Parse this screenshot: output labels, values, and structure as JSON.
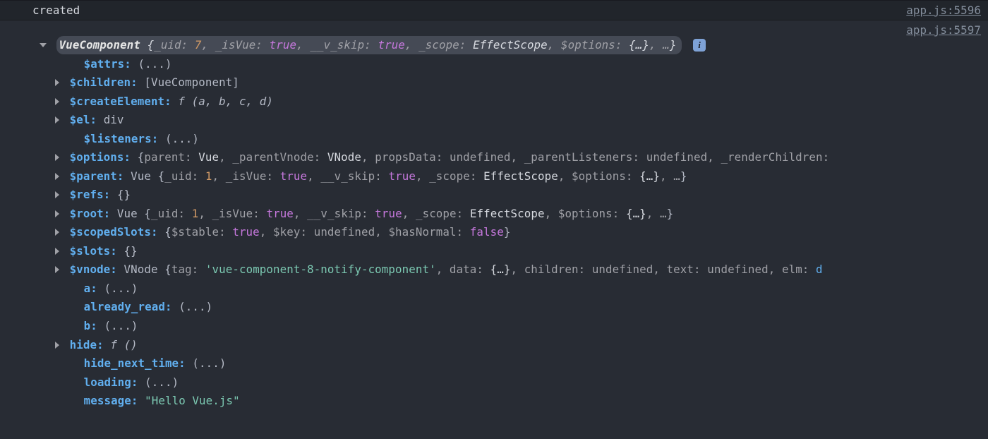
{
  "rows": [
    {
      "message": "created",
      "source_link": "app.js:5596"
    }
  ],
  "source_link_2": "app.js:5597",
  "summary": {
    "type": "VueComponent",
    "_uid_label": "_uid:",
    "_uid": "7",
    "_isVue_label": "_isVue:",
    "_isVue": "true",
    "_v_skip_label": "__v_skip:",
    "_v_skip": "true",
    "_scope_label": "_scope:",
    "_scope": "EffectScope",
    "_options_label": "$options:",
    "_options": "{…}",
    "more": "…",
    "info_badge": "i"
  },
  "props": {
    "attrs": {
      "key": "$attrs:",
      "value": "(...)"
    },
    "children": {
      "key": "$children:",
      "value": "[VueComponent]"
    },
    "createElement": {
      "key": "$createElement:",
      "fn_f": "f",
      "fn_args": "(a, b, c, d)"
    },
    "el": {
      "key": "$el:",
      "value": "div"
    },
    "listeners": {
      "key": "$listeners:",
      "value": "(...)"
    },
    "options": {
      "key": "$options:",
      "parts": {
        "open": "{",
        "p1k": "parent:",
        "p1v": "Vue",
        "p2k": "_parentVnode:",
        "p2v": "VNode",
        "p3k": "propsData:",
        "p3v": "undefined",
        "p4k": "_parentListeners:",
        "p4v": "undefined",
        "p5k": "_renderChildren:"
      }
    },
    "parent": {
      "key": "$parent:",
      "type": "Vue",
      "parts": {
        "open": "{",
        "uidk": "_uid:",
        "uid": "1",
        "isvk": "_isVue:",
        "isv": "true",
        "vsk": "__v_skip:",
        "vs": "true",
        "sck": "_scope:",
        "sc": "EffectScope",
        "opk": "$options:",
        "op": "{…}",
        "more": "…",
        "close": "}"
      }
    },
    "refs": {
      "key": "$refs:",
      "value": "{}"
    },
    "root": {
      "key": "$root:",
      "type": "Vue",
      "parts": {
        "open": "{",
        "uidk": "_uid:",
        "uid": "1",
        "isvk": "_isVue:",
        "isv": "true",
        "vsk": "__v_skip:",
        "vs": "true",
        "sck": "_scope:",
        "sc": "EffectScope",
        "opk": "$options:",
        "op": "{…}",
        "more": "…",
        "close": "}"
      }
    },
    "scopedSlots": {
      "key": "$scopedSlots:",
      "parts": {
        "open": "{",
        "p1k": "$stable:",
        "p1v": "true",
        "p2k": "$key:",
        "p2v": "undefined",
        "p3k": "$hasNormal:",
        "p3v": "false",
        "close": "}"
      }
    },
    "slots": {
      "key": "$slots:",
      "value": "{}"
    },
    "vnode": {
      "key": "$vnode:",
      "type": "VNode",
      "parts": {
        "open": "{",
        "p1k": "tag:",
        "p1v": "'vue-component-8-notify-component'",
        "p2k": "data:",
        "p2v": "{…}",
        "p3k": "children:",
        "p3v": "undefined",
        "p4k": "text:",
        "p4v": "undefined",
        "p5k": "elm:",
        "p5v": "d"
      }
    },
    "a": {
      "key": "a:",
      "value": "(...)"
    },
    "already_read": {
      "key": "already_read:",
      "value": "(...)"
    },
    "b": {
      "key": "b:",
      "value": "(...)"
    },
    "hide": {
      "key": "hide:",
      "fn_f": "f",
      "fn_args": "()"
    },
    "hide_next_time": {
      "key": "hide_next_time:",
      "value": "(...)"
    },
    "loading": {
      "key": "loading:",
      "value": "(...)"
    },
    "message": {
      "key": "message:",
      "value": "\"Hello Vue.js\""
    }
  }
}
